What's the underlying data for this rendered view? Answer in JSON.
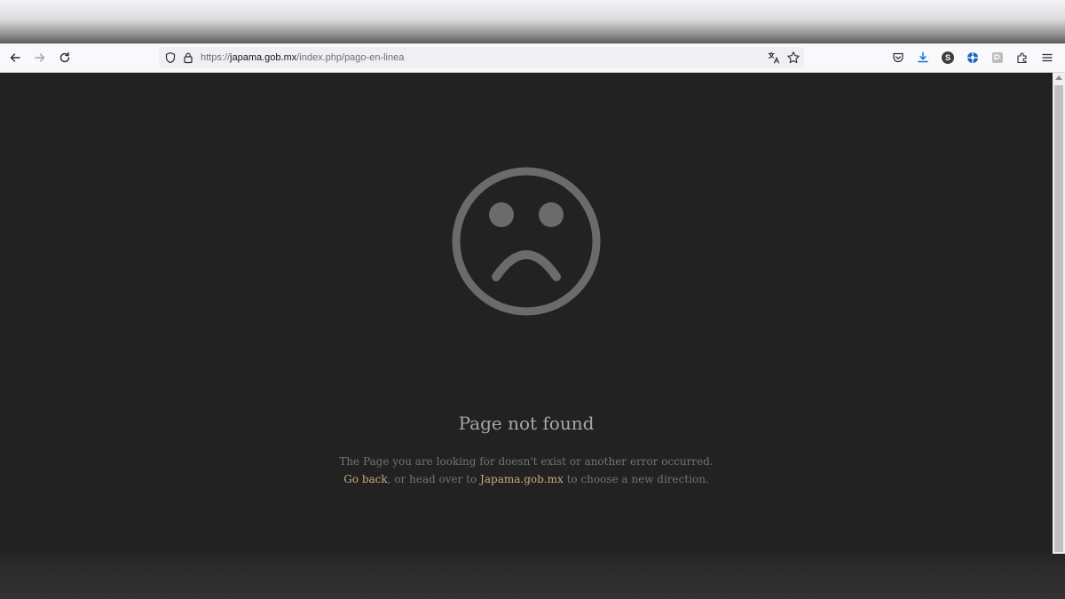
{
  "browser": {
    "url_scheme": "https://",
    "url_host": "japama.gob.mx",
    "url_path": "/index.php/pago-en-linea",
    "extensions": [
      {
        "name": "s-extension",
        "letter": "S",
        "color": "#3d3d3d"
      },
      {
        "name": "blue-extension",
        "letter": "",
        "color": "#1667c2"
      },
      {
        "name": "grey-extension",
        "letter": "",
        "color": "#bdbdbd"
      }
    ]
  },
  "page": {
    "title": "Page not found",
    "message_line1": "The Page you are looking for doesn't exist or another error occurred.",
    "go_back": "Go back",
    "middle": ", or head over to ",
    "site_link": "Japama.gob.mx",
    "end": " to choose a new direction."
  },
  "colors": {
    "background": "#222222",
    "icon": "#6b6b6b",
    "link": "#c9aa7c"
  }
}
